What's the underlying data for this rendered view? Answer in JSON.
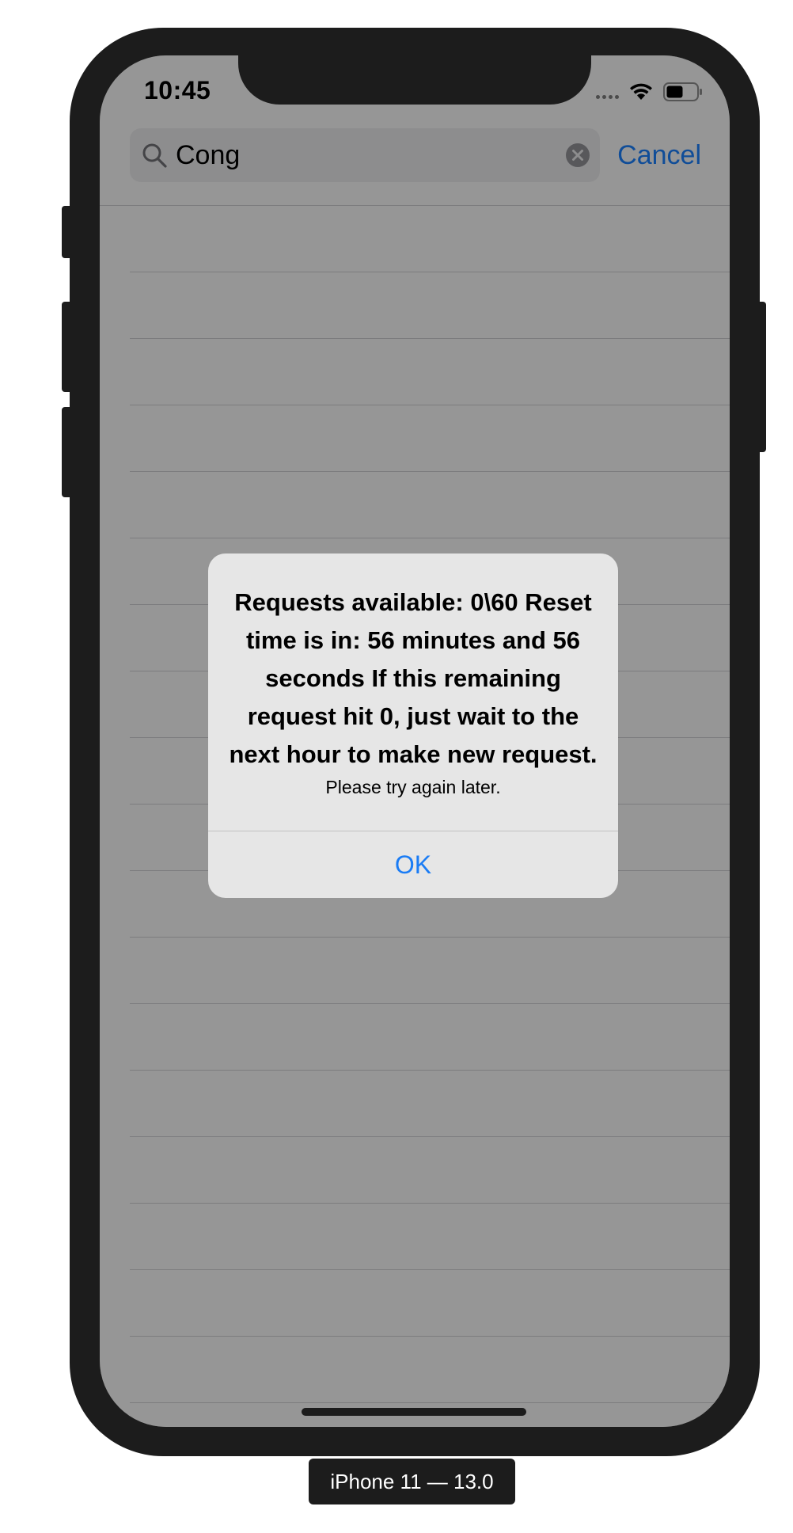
{
  "status_bar": {
    "time": "10:45",
    "icons": [
      "cellular-signal-icon",
      "wifi-icon",
      "battery-icon"
    ]
  },
  "search": {
    "value": "Cong",
    "placeholder": "",
    "cancel_label": "Cancel",
    "icons": [
      "search-icon",
      "clear-icon"
    ]
  },
  "alert": {
    "title": "Requests available: 0\\60\nReset time is in: 56 minutes and 56 seconds\nIf this remaining request hit 0, just wait to the next hour to make new request.",
    "message": "Please try again later.",
    "ok_label": "OK"
  },
  "device": {
    "label": "iPhone 11 — 13.0"
  },
  "colors": {
    "accent": "#1a7cf5",
    "frame": "#1c1c1c",
    "alert_background": "#e6e6e6",
    "separator": "#c8c8cc"
  }
}
